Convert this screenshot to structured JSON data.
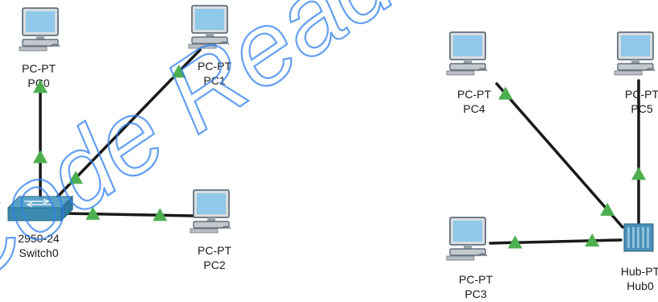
{
  "colors": {
    "link": "#1a1a1a",
    "link_up_indicator": "#4caf50",
    "pc_screen": "#8fc8e8",
    "pc_frame": "#4a5a68",
    "switch_body": "#3b8bb0",
    "hub_body": "#4a90b8",
    "watermark": "#2f80ed"
  },
  "watermark": {
    "text": "Code Reader"
  },
  "nodes": [
    {
      "id": "PC0",
      "device_model": "PC-PT",
      "name": "PC0",
      "icon": "pc-icon"
    },
    {
      "id": "PC1",
      "device_model": "PC-PT",
      "name": "PC1",
      "icon": "pc-icon"
    },
    {
      "id": "PC2",
      "device_model": "PC-PT",
      "name": "PC2",
      "icon": "pc-icon"
    },
    {
      "id": "Switch0",
      "device_model": "2950-24",
      "name": "Switch0",
      "icon": "switch-icon"
    },
    {
      "id": "PC4",
      "device_model": "PC-PT",
      "name": "PC4",
      "icon": "pc-icon"
    },
    {
      "id": "PC5",
      "device_model": "PC-PT",
      "name": "PC5",
      "icon": "pc-icon"
    },
    {
      "id": "PC3",
      "device_model": "PC-PT",
      "name": "PC3",
      "icon": "pc-icon"
    },
    {
      "id": "Hub0",
      "device_model": "Hub-PT",
      "name": "Hub0",
      "icon": "hub-icon"
    }
  ],
  "links": [
    {
      "from": "Switch0",
      "to": "PC0",
      "status": "up"
    },
    {
      "from": "Switch0",
      "to": "PC1",
      "status": "up"
    },
    {
      "from": "Switch0",
      "to": "PC2",
      "status": "up"
    },
    {
      "from": "Hub0",
      "to": "PC4",
      "status": "up"
    },
    {
      "from": "Hub0",
      "to": "PC5",
      "status": "up"
    },
    {
      "from": "Hub0",
      "to": "PC3",
      "status": "up"
    }
  ]
}
